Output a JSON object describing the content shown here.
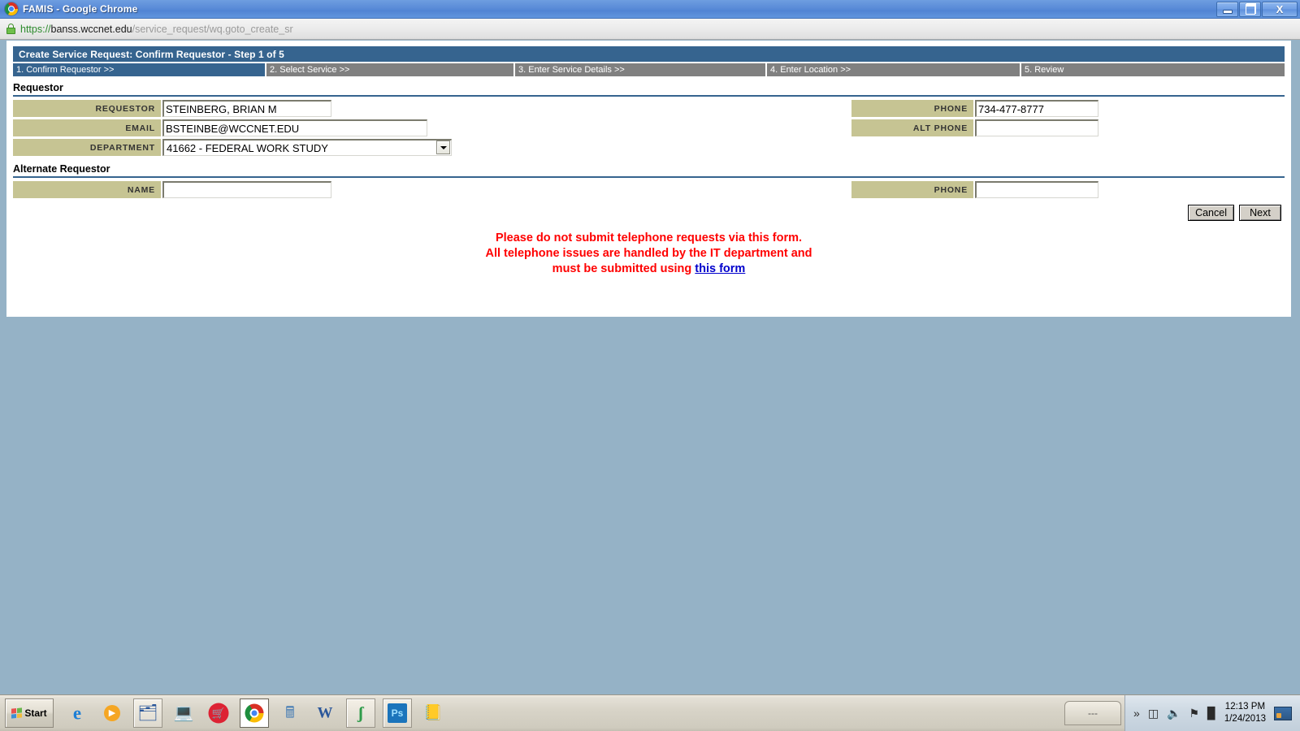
{
  "window": {
    "title": "FAMIS - Google Chrome",
    "logo_icon": "chrome-logo-icon",
    "minimize_label": "",
    "maximize_label": "",
    "close_label": "X"
  },
  "address_bar": {
    "lock_icon": "padlock-icon",
    "url_scheme": "https://",
    "url_host": "banss.wccnet.edu",
    "url_path": "/service_request/wq.goto_create_sr",
    "url_full": "https://banss.wccnet.edu/service_request/wq.goto_create_sr"
  },
  "app": {
    "header_title": "Create Service Request: Confirm Requestor - Step 1 of 5",
    "steps": [
      {
        "label": "1. Confirm Requestor >>",
        "active": true
      },
      {
        "label": "2. Select Service >>",
        "active": false
      },
      {
        "label": "3. Enter Service Details >>",
        "active": false
      },
      {
        "label": "4. Enter Location >>",
        "active": false
      },
      {
        "label": "5. Review",
        "active": false
      }
    ]
  },
  "requestor_section": {
    "title": "Requestor",
    "fields": {
      "requestor_label": "REQUESTOR",
      "requestor_value": "STEINBERG, BRIAN M",
      "email_label": "EMAIL",
      "email_value": "BSTEINBE@WCCNET.EDU",
      "department_label": "DEPARTMENT",
      "department_value": "41662 - FEDERAL WORK STUDY",
      "department_arrow_icon": "chevron-down-icon",
      "phone_label": "PHONE",
      "phone_value": "734-477-8777",
      "alt_phone_label": "ALT PHONE",
      "alt_phone_value": "",
      "alt_phone_placeholder": ""
    }
  },
  "alternate_section": {
    "title": "Alternate Requestor",
    "fields": {
      "name_label": "NAME",
      "name_value": "",
      "name_placeholder": "",
      "phone_label": "PHONE",
      "phone_value": "",
      "phone_placeholder": ""
    }
  },
  "actions": {
    "cancel_label": "Cancel",
    "next_label": "Next"
  },
  "warning": {
    "line1": "Please do not submit telephone requests via this form.",
    "line2": "All telephone issues are handled by the IT department and",
    "line3_prefix": "must be submitted using ",
    "link_label": "this form"
  },
  "taskbar": {
    "start_label": "Start",
    "start_icon": "windows-flag-icon",
    "quick_launch": [
      {
        "name": "internet-explorer-icon",
        "glyph": "🌐",
        "framed": false
      },
      {
        "name": "windows-media-player-icon",
        "glyph": "▶",
        "framed": false
      },
      {
        "name": "file-explorer-icon",
        "glyph": "🗂",
        "framed": true
      },
      {
        "name": "laptop-icon",
        "glyph": "💻",
        "framed": false
      },
      {
        "name": "shopping-cart-icon",
        "glyph": "🛒",
        "framed": false
      },
      {
        "name": "google-chrome-icon",
        "glyph": "◉",
        "framed": true
      },
      {
        "name": "calculator-icon",
        "glyph": "🧮",
        "framed": false
      },
      {
        "name": "microsoft-word-icon",
        "glyph": "W",
        "framed": false
      },
      {
        "name": "snagit-icon",
        "glyph": "ʃ",
        "framed": true
      },
      {
        "name": "photoshop-icon",
        "glyph": "Ps",
        "framed": true
      },
      {
        "name": "notebook-icon",
        "glyph": "📓",
        "framed": false
      }
    ],
    "language_bar": "---",
    "tray_icons": [
      {
        "name": "show-hidden-icons-icon",
        "glyph": "»"
      },
      {
        "name": "battery-icon",
        "glyph": "🔋"
      },
      {
        "name": "volume-icon",
        "glyph": "🔊"
      },
      {
        "name": "flag-action-center-icon",
        "glyph": "⚑"
      },
      {
        "name": "network-signal-icon",
        "glyph": "ᴷ"
      }
    ],
    "clock_time": "12:13 PM",
    "clock_date": "1/24/2013",
    "show_desktop_icon": "show-desktop-icon"
  },
  "colors": {
    "app_header_blue": "#36648f",
    "step_inactive_gray": "#808080",
    "label_khaki": "#c6c493",
    "warning_red": "#ff0000",
    "link_blue": "#0000cc",
    "desktop_blue_gray": "#95b2c6",
    "title_bar_blue": "#5588d6"
  }
}
